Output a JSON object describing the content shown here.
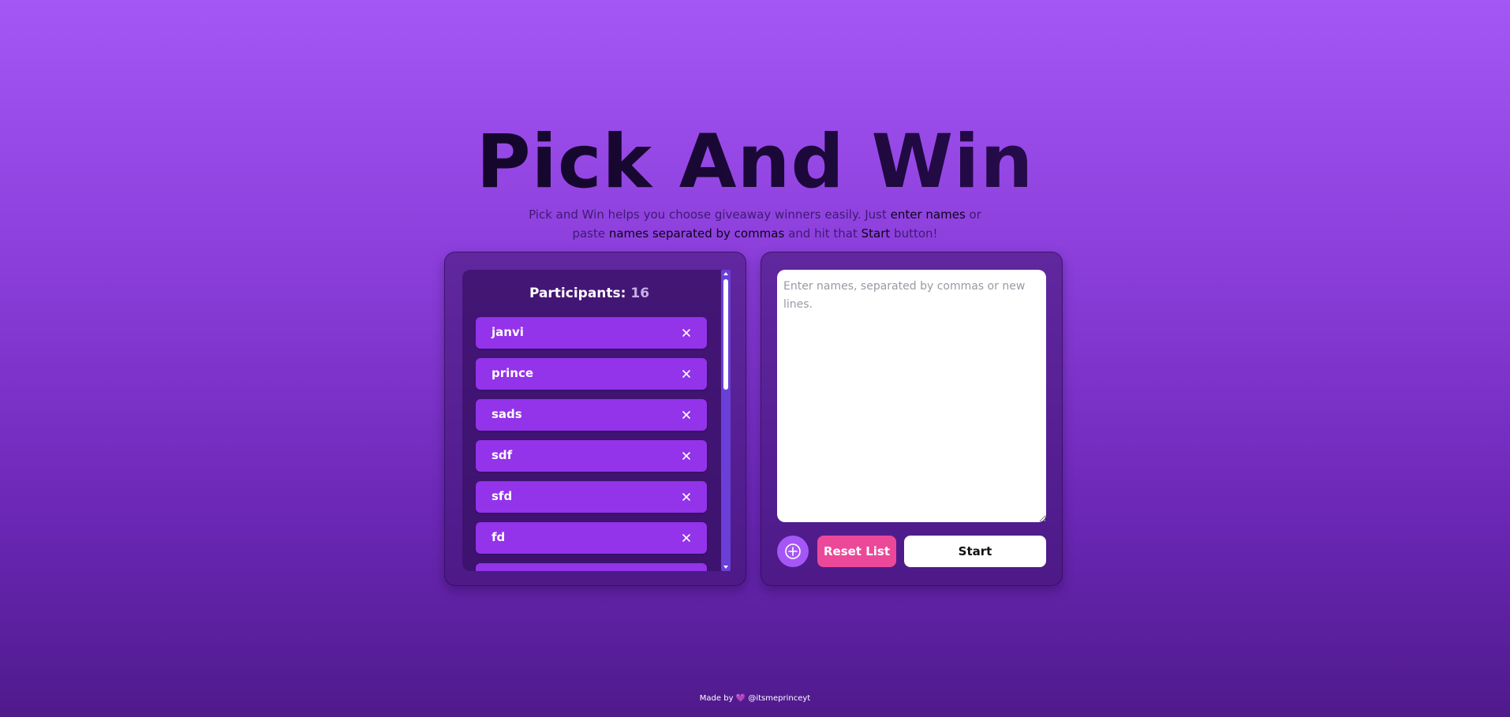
{
  "header": {
    "title": "Pick And Win",
    "subtitle": {
      "part1": "Pick and Win helps you choose giveaway winners easily. Just ",
      "highlight1": "enter names",
      "part2": " or paste ",
      "highlight2": "names separated by commas",
      "part3": " and hit that ",
      "highlight3": "Start",
      "part4": " button!"
    }
  },
  "participants": {
    "label": "Participants:",
    "count": "16",
    "remove_icon": "close-icon",
    "items": [
      "janvi",
      "prince",
      "sads",
      "sdf",
      "sfd",
      "fd",
      ""
    ]
  },
  "entry": {
    "placeholder": "Enter names, separated by commas or new lines.",
    "add_icon": "plus-icon",
    "reset_label": "Reset List",
    "start_label": "Start"
  },
  "footer": {
    "prefix": "Made by",
    "heart": "💜",
    "handle": "@itsmeprinceyt"
  },
  "colors": {
    "background_top": "#a557f5",
    "background_bottom": "#4f1a8c",
    "item_bg": "#9333ea",
    "reset_bg": "#ec4899",
    "start_bg": "#ffffff",
    "add_bg": "#a557f5"
  }
}
